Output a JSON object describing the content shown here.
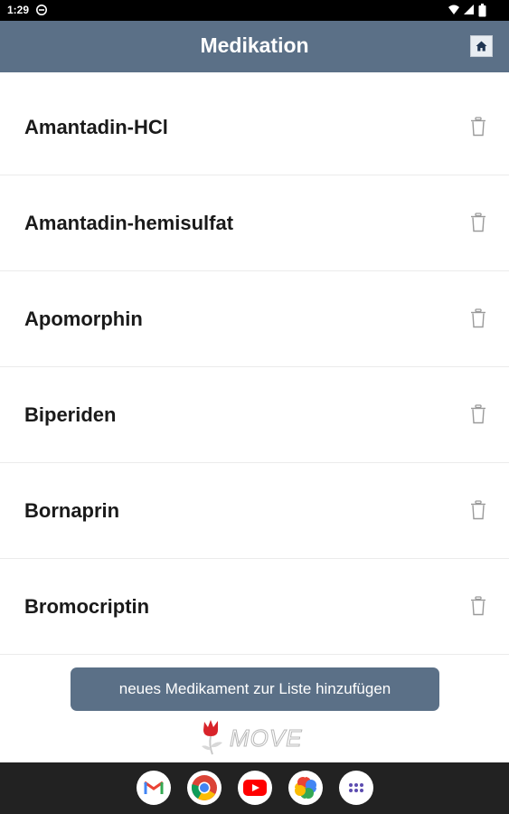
{
  "status_bar": {
    "time": "1:29",
    "icons": [
      "do-not-disturb-icon",
      "wifi-icon",
      "signal-icon",
      "battery-icon"
    ]
  },
  "header": {
    "title": "Medikation",
    "home_icon": "home-icon",
    "background": "#5b7087"
  },
  "medications": [
    {
      "name": "Amantadin-HCl"
    },
    {
      "name": "Amantadin-hemisulfat"
    },
    {
      "name": "Apomorphin"
    },
    {
      "name": "Biperiden"
    },
    {
      "name": "Bornaprin"
    },
    {
      "name": "Bromocriptin"
    }
  ],
  "add_button": {
    "label": "neues Medikament zur Liste hinzufügen"
  },
  "logo": {
    "text": "MOVE"
  },
  "dock": {
    "apps": [
      "gmail-icon",
      "chrome-icon",
      "youtube-icon",
      "photos-icon",
      "app-drawer-icon"
    ]
  },
  "colors": {
    "accent": "#5b7087",
    "logo_red": "#d8232a"
  }
}
